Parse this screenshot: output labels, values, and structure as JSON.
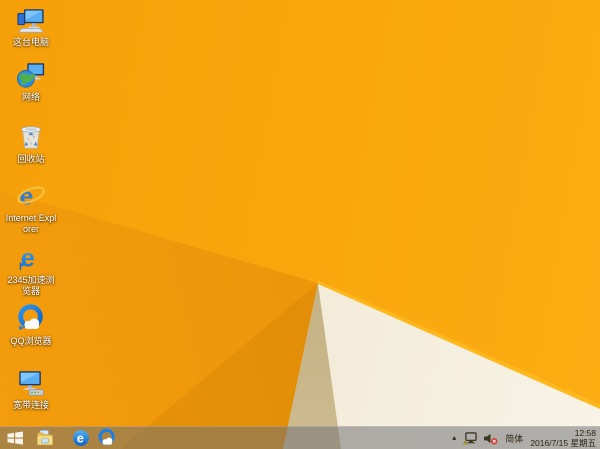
{
  "desktop": {
    "icons": [
      {
        "id": "this-pc",
        "label": "这台电脑"
      },
      {
        "id": "network",
        "label": "网络"
      },
      {
        "id": "recycle-bin",
        "label": "回收站"
      },
      {
        "id": "internet-explorer",
        "label": "Internet Explorer"
      },
      {
        "id": "2345-browser",
        "label": "2345加速浏览器"
      },
      {
        "id": "qq-browser",
        "label": "QQ浏览器"
      },
      {
        "id": "broadband",
        "label": "宽带连接"
      }
    ]
  },
  "taskbar": {
    "buttons": [
      {
        "id": "start",
        "name": "Windows 开始"
      },
      {
        "id": "file-explorer",
        "name": "文件资源管理器"
      },
      {
        "id": "2345-browser",
        "name": "2345加速浏览器"
      },
      {
        "id": "qq-browser",
        "name": "QQ浏览器"
      }
    ],
    "tray": {
      "overflow_arrow": "▴",
      "network_status": "network-warning",
      "volume_status": "muted",
      "input_method": "简体",
      "clock": {
        "time": "12:58",
        "date": "2016/7/15 星期五"
      }
    }
  },
  "colors": {
    "wallpaper_orange": "#f8a50d",
    "wallpaper_deep_orange": "#e8920a",
    "wallpaper_cream": "#f3ecd8",
    "wallpaper_khaki": "#c0ad7d",
    "wallpaper_ridge": "#ffb71e",
    "taskbar_overlay": "rgba(109,112,117,0.52)",
    "tray_text": "#2e2614"
  }
}
